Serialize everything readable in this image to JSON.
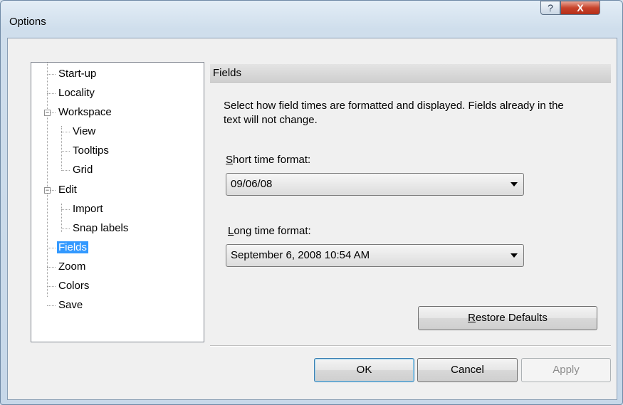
{
  "window": {
    "title": "Options",
    "help_glyph": "?",
    "close_glyph": "X"
  },
  "tree": {
    "items": [
      {
        "label": "Start-up",
        "level": 0
      },
      {
        "label": "Locality",
        "level": 0
      },
      {
        "label": "Workspace",
        "level": 0,
        "expanded": true
      },
      {
        "label": "View",
        "level": 1
      },
      {
        "label": "Tooltips",
        "level": 1
      },
      {
        "label": "Grid",
        "level": 1
      },
      {
        "label": "Edit",
        "level": 0,
        "expanded": true
      },
      {
        "label": "Import",
        "level": 1
      },
      {
        "label": "Snap labels",
        "level": 1
      },
      {
        "label": "Fields",
        "level": 0,
        "selected": true
      },
      {
        "label": "Zoom",
        "level": 0
      },
      {
        "label": "Colors",
        "level": 0
      },
      {
        "label": "Save",
        "level": 0
      }
    ],
    "expander_glyph": "−"
  },
  "panel": {
    "header": "Fields",
    "description": "Select how field times are formatted and displayed. Fields already in the text will not change.",
    "short_format": {
      "label_mnemonic": "S",
      "label_rest": "hort time format:",
      "value": "09/06/08"
    },
    "long_format": {
      "label_mnemonic": "L",
      "label_rest": "ong time format:",
      "value": "September 6, 2008 10:54 AM"
    },
    "restore_mnemonic": "R",
    "restore_rest": "estore Defaults"
  },
  "buttons": {
    "ok": "OK",
    "cancel": "Cancel",
    "apply": "Apply"
  },
  "colors": {
    "selection": "#3399ff",
    "close_button": "#c7432b"
  }
}
